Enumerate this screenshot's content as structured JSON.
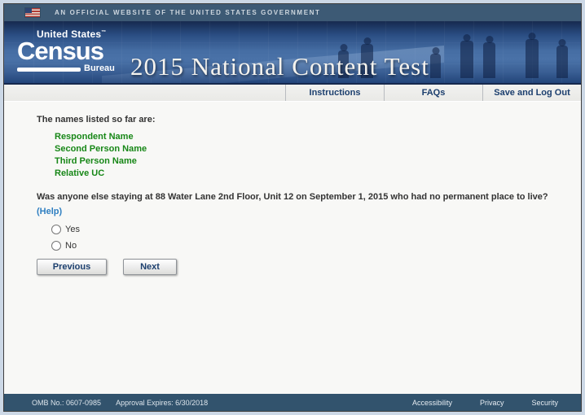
{
  "official_banner": {
    "text": "AN OFFICIAL WEBSITE OF THE UNITED STATES GOVERNMENT"
  },
  "header": {
    "logo": {
      "line1": "United States",
      "trademark": "™",
      "line2": "Census",
      "line3": "Bureau"
    },
    "title": "2015 National Content Test"
  },
  "nav": {
    "items": [
      {
        "label": "Instructions"
      },
      {
        "label": "FAQs"
      },
      {
        "label": "Save and Log Out"
      }
    ]
  },
  "main": {
    "names_intro": "The names listed so far are:",
    "names": [
      "Respondent Name",
      "Second Person Name",
      "Third Person Name",
      "Relative UC"
    ],
    "question": "Was anyone else staying at 88 Water Lane 2nd Floor, Unit 12 on September 1, 2015 who had no permanent place to live?",
    "help_label": "(Help)",
    "options": [
      {
        "label": "Yes",
        "selected": false
      },
      {
        "label": "No",
        "selected": false
      }
    ],
    "previous_label": "Previous",
    "next_label": "Next"
  },
  "footer": {
    "omb": "OMB No.: 0607-0985",
    "approval": "Approval Expires: 6/30/2018",
    "links": [
      {
        "label": "Accessibility"
      },
      {
        "label": "Privacy"
      },
      {
        "label": "Security"
      }
    ]
  },
  "colors": {
    "nav_link_blue": "#1c3f6e",
    "help_link_blue": "#2f7fc1",
    "name_green": "#178717",
    "banner_blue": "#41699f",
    "footer_slate": "#32536d",
    "official_bar_slate": "#3d5a75"
  }
}
